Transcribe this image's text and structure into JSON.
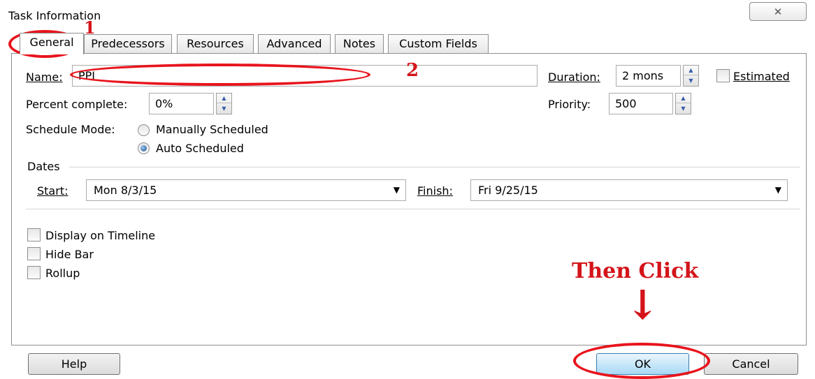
{
  "window": {
    "title": "Task Information",
    "close_glyph": "✕"
  },
  "tabs": [
    {
      "label": "General",
      "active": true
    },
    {
      "label": "Predecessors"
    },
    {
      "label": "Resources"
    },
    {
      "label": "Advanced"
    },
    {
      "label": "Notes"
    },
    {
      "label": "Custom Fields"
    }
  ],
  "general": {
    "name_label": "Name:",
    "name_value": "PPI",
    "duration_label": "Duration:",
    "duration_value": "2 mons",
    "estimated_label": "Estimated",
    "percent_label": "Percent complete:",
    "percent_value": "0%",
    "priority_label": "Priority:",
    "priority_value": "500",
    "schedule_mode_label": "Schedule Mode:",
    "schedule_options": [
      "Manually Scheduled",
      "Auto Scheduled"
    ],
    "schedule_selected": "Auto Scheduled",
    "dates_label": "Dates",
    "start_label": "Start:",
    "start_value": "Mon 8/3/15",
    "finish_label": "Finish:",
    "finish_value": "Fri 9/25/15",
    "checkboxes": [
      "Display on Timeline",
      "Hide Bar",
      "Rollup"
    ]
  },
  "buttons": {
    "help": "Help",
    "ok": "OK",
    "cancel": "Cancel"
  },
  "annotations": {
    "step1": "1",
    "step2": "2",
    "then_click": "Then Click",
    "arrow": "↓"
  },
  "colors": {
    "annotation_red": "#e8141c",
    "ok_accent": "#a7d9f5",
    "radio_dot": "#1a4f8f"
  }
}
